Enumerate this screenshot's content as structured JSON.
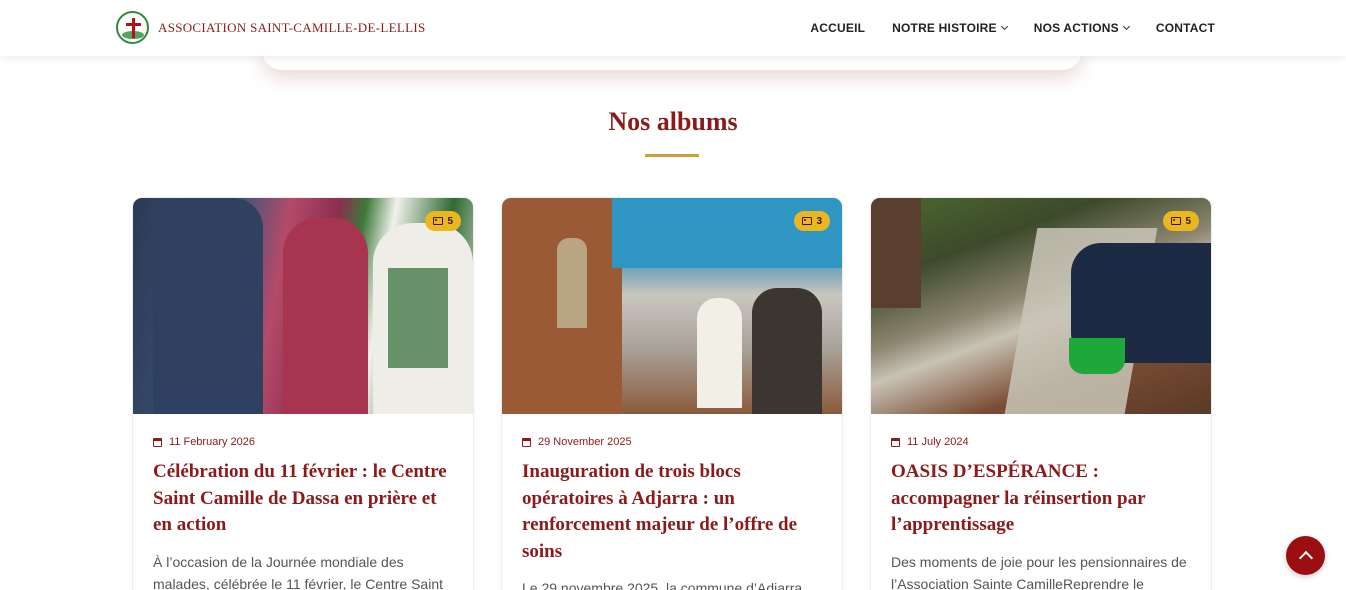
{
  "brand": {
    "name": "ASSOCIATION SAINT-CAMILLE-DE-LELLIS"
  },
  "nav": {
    "items": [
      {
        "label": "ACCUEIL",
        "dropdown": false
      },
      {
        "label": "NOTRE HISTOIRE",
        "dropdown": true
      },
      {
        "label": "NOS ACTIONS",
        "dropdown": true
      },
      {
        "label": "CONTACT",
        "dropdown": false
      }
    ]
  },
  "section": {
    "title": "Nos albums"
  },
  "albums": [
    {
      "photo_count": "5",
      "date": "11 February 2026",
      "title": "Célébration du 11 février : le Centre Saint Camille de Dassa en prière et en action",
      "excerpt": "À l’occasion de la Journée mondiale des malades, célébrée le 11 février, le Centre Saint"
    },
    {
      "photo_count": "3",
      "date": "29 November 2025",
      "title": "Inauguration de trois blocs opératoires à Adjarra : un renforcement majeur de l’offre de soins",
      "excerpt": "Le 29 novembre 2025, la commune d’Adjarra"
    },
    {
      "photo_count": "5",
      "date": "11 July 2024",
      "title": "OASIS D’ESPÉRANCE : accompagner la réinsertion par l’apprentissage",
      "excerpt": "Des moments de joie pour les pensionnaires de l’Association Sainte CamilleReprendre le"
    }
  ],
  "colors": {
    "primary": "#8b1a1a",
    "accent": "#c9a13a",
    "badge": "#e9b720",
    "back_to_top": "#9b0e12"
  }
}
